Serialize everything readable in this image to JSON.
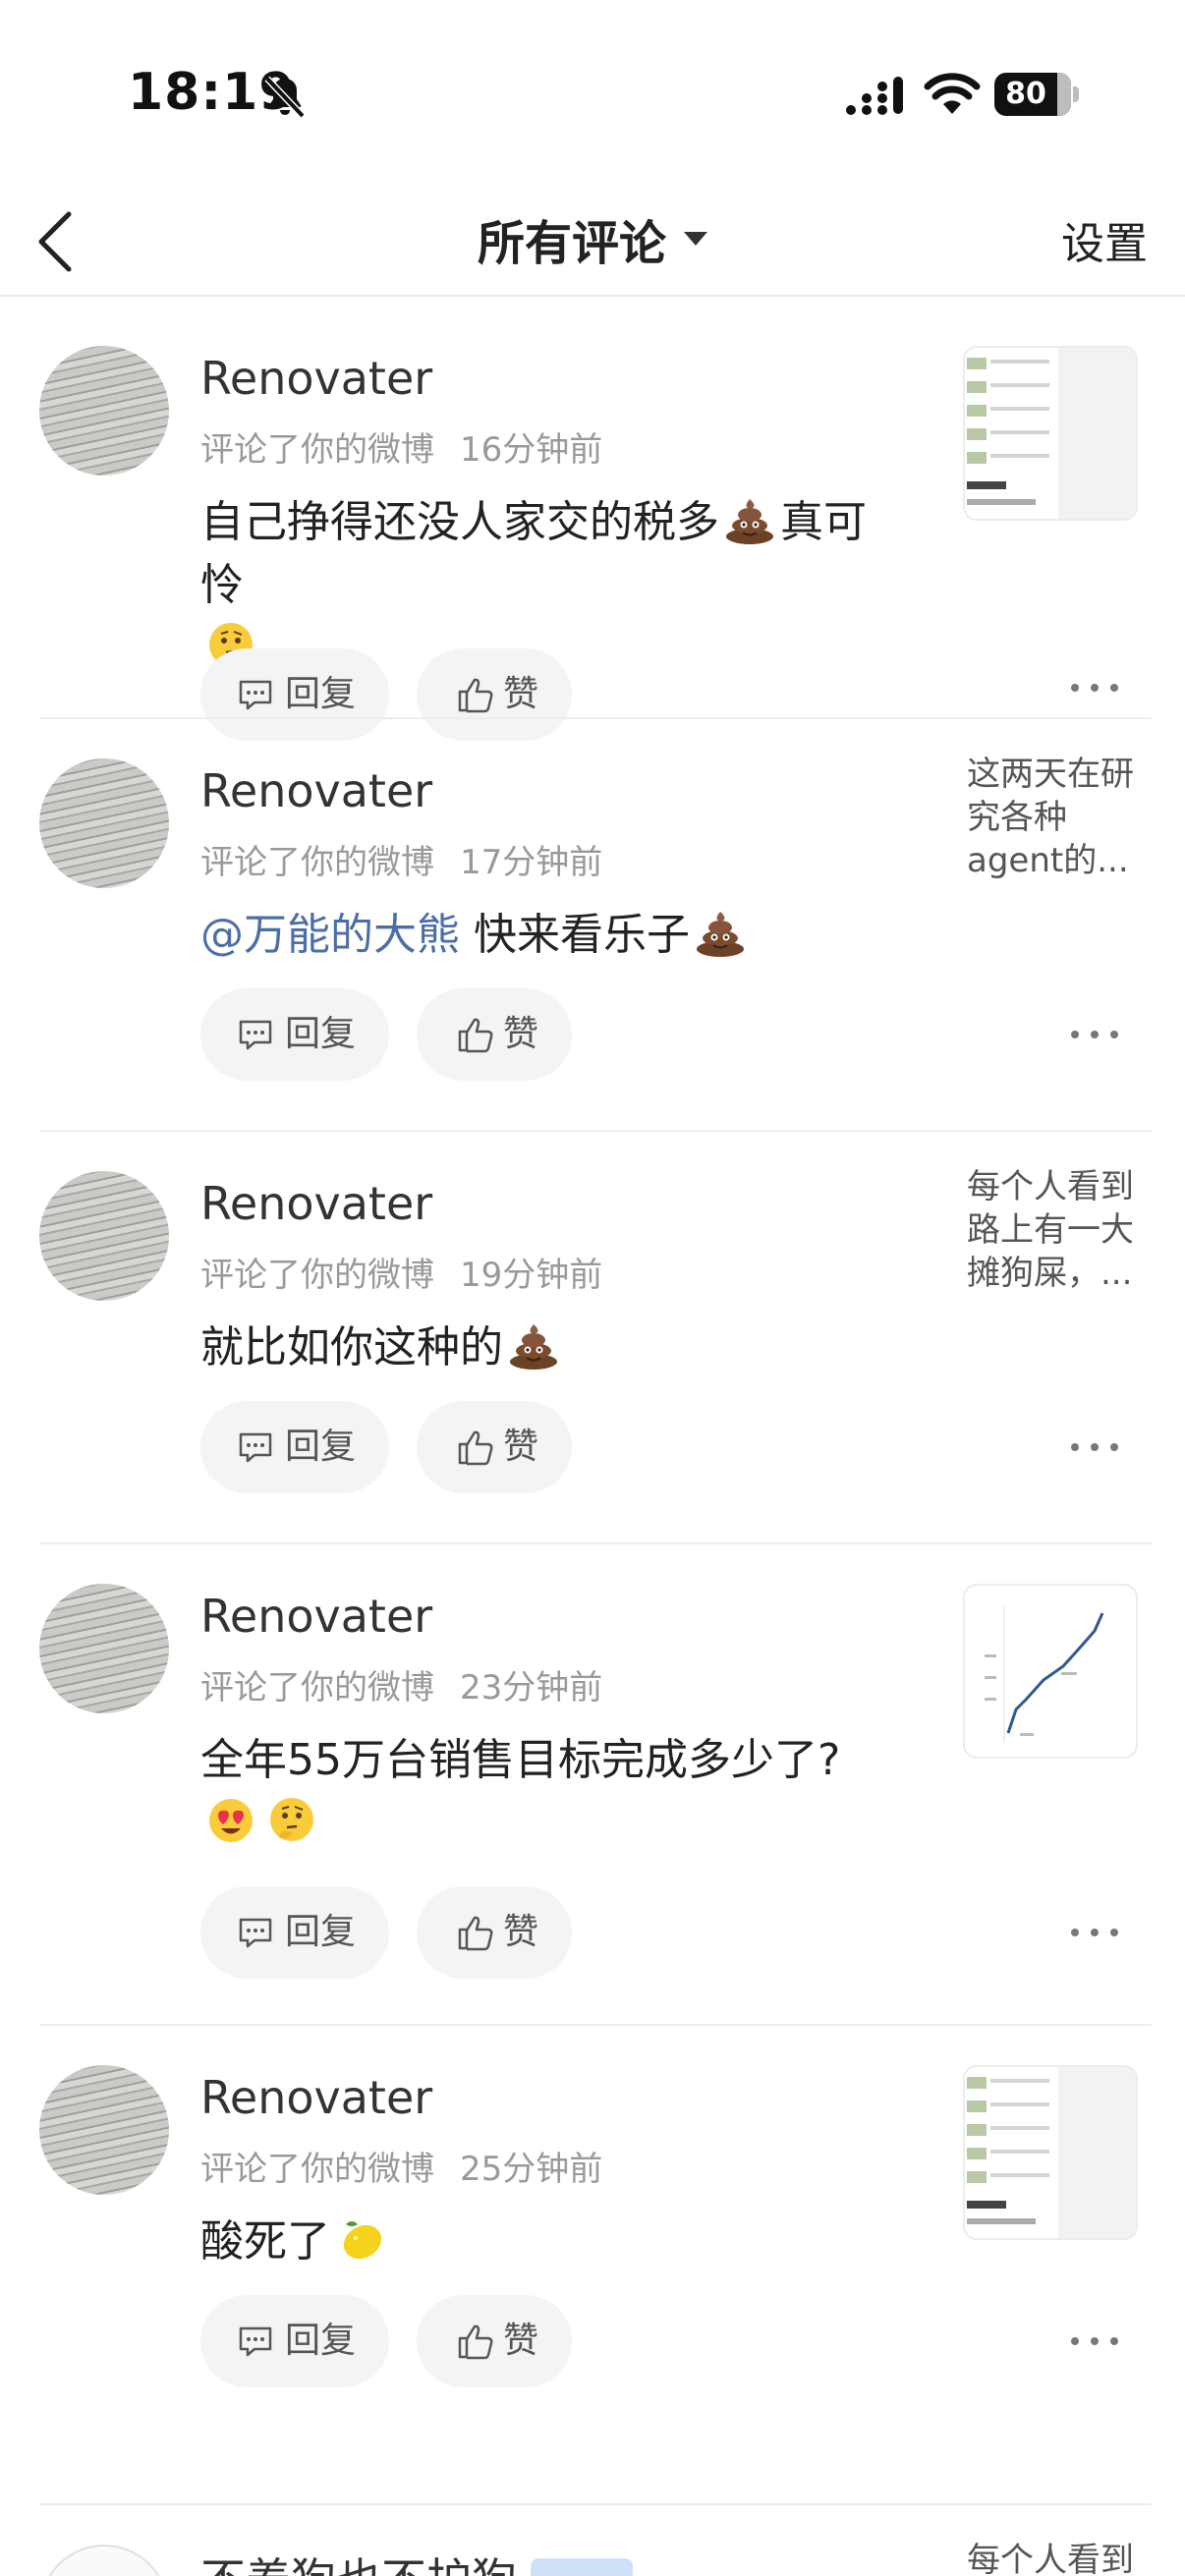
{
  "status_bar": {
    "time": "18:19",
    "battery_level": "80",
    "icons": [
      "bell-slash-icon",
      "cellular-signal-icon",
      "wifi-icon",
      "battery-icon"
    ]
  },
  "nav": {
    "title": "所有评论",
    "settings_label": "设置",
    "icons": [
      "chevron-left-icon",
      "caret-down-icon"
    ]
  },
  "comments": [
    {
      "author": "Renovater",
      "action": "评论了你的微博",
      "time": "16分钟前",
      "text": "自己挣得还没人家交的税多",
      "text_after": "真可怜",
      "emojis": [
        "poop-emoji",
        "thinking-emoji"
      ],
      "thumbnail": "image",
      "reply_label": "回复",
      "like_label": "赞"
    },
    {
      "author": "Renovater",
      "action": "评论了你的微博",
      "time": "17分钟前",
      "mention": "@万能的大熊",
      "text": "快来看乐子",
      "emojis": [
        "poop-emoji"
      ],
      "thumbnail_text": "这两天在研究各种agent的...",
      "reply_label": "回复",
      "like_label": "赞"
    },
    {
      "author": "Renovater",
      "action": "评论了你的微博",
      "time": "19分钟前",
      "text": "就比如你这种的",
      "emojis": [
        "poop-emoji"
      ],
      "thumbnail_text": "每个人看到路上有一大摊狗屎，...",
      "reply_label": "回复",
      "like_label": "赞"
    },
    {
      "author": "Renovater",
      "action": "评论了你的微博",
      "time": "23分钟前",
      "text": "全年55万台销售目标完成多少了?",
      "emojis": [
        "heart-eyes-emoji",
        "thinking-emoji"
      ],
      "thumbnail": "chart-image",
      "reply_label": "回复",
      "like_label": "赞"
    },
    {
      "author": "Renovater",
      "action": "评论了你的微博",
      "time": "25分钟前",
      "text": "酸死了",
      "emojis": [
        "lemon-emoji"
      ],
      "thumbnail": "image",
      "reply_label": "回复",
      "like_label": "赞"
    }
  ],
  "partial_item": {
    "author": "不养狗也不护狗",
    "thumbnail_text": "每个人看到"
  }
}
